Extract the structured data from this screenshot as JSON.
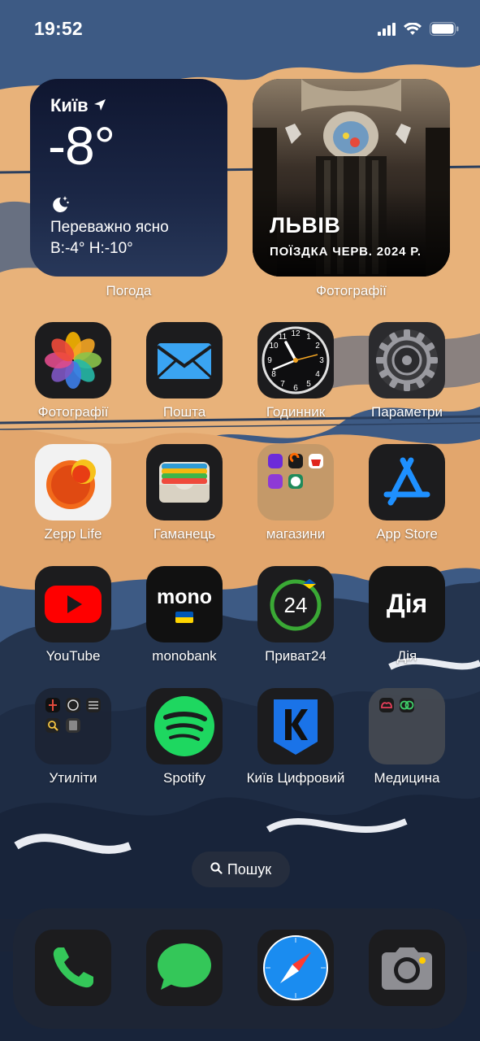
{
  "status_bar": {
    "time": "19:52",
    "signal_icon": "cellular-signal-icon",
    "wifi_icon": "wifi-icon",
    "battery_icon": "battery-full-icon"
  },
  "widgets": {
    "weather": {
      "city": "Київ",
      "temperature": "-8°",
      "condition": "Переважно ясно",
      "range": "В:-4° Н:-10°",
      "label": "Погода",
      "condition_icon": "moon-stars-icon"
    },
    "photos": {
      "title": "ЛЬВІВ",
      "subtitle": "ПОЇЗДКА ЧЕРВ. 2024 Р.",
      "label": "Фотографії"
    }
  },
  "apps": [
    {
      "label": "Фотографії",
      "icon": "photos-flower-icon"
    },
    {
      "label": "Пошта",
      "icon": "mail-envelope-icon"
    },
    {
      "label": "Годинник",
      "icon": "clock-icon"
    },
    {
      "label": "Параметри",
      "icon": "settings-gear-icon"
    },
    {
      "label": "Zepp Life",
      "icon": "zepp-life-icon"
    },
    {
      "label": "Гаманець",
      "icon": "wallet-icon"
    },
    {
      "label": "магазини",
      "icon": "folder-icon"
    },
    {
      "label": "App Store",
      "icon": "app-store-icon"
    },
    {
      "label": "YouTube",
      "icon": "youtube-icon"
    },
    {
      "label": "monobank",
      "icon": "monobank-icon",
      "icon_text": "mono"
    },
    {
      "label": "Приват24",
      "icon": "privat24-icon",
      "icon_text": "24"
    },
    {
      "label": "Дія",
      "icon": "diia-icon",
      "icon_text": "Дія"
    },
    {
      "label": "Утиліти",
      "icon": "folder-icon"
    },
    {
      "label": "Spotify",
      "icon": "spotify-icon"
    },
    {
      "label": "Київ Цифровий",
      "icon": "kyiv-digital-icon"
    },
    {
      "label": "Медицина",
      "icon": "folder-icon"
    }
  ],
  "search": {
    "label": "Пошук"
  },
  "dock": [
    {
      "name": "phone",
      "icon": "phone-icon"
    },
    {
      "name": "messages",
      "icon": "messages-icon"
    },
    {
      "name": "safari",
      "icon": "safari-compass-icon"
    },
    {
      "name": "camera",
      "icon": "camera-icon"
    }
  ],
  "colors": {
    "sky": "#3d5a84",
    "sand": "#e8b27a",
    "mono_yellow": "#ffd500",
    "mono_blue": "#0057b7",
    "youtube_red": "#ff0000",
    "spotify_green": "#1ed760",
    "privat_green": "#3aa935"
  }
}
